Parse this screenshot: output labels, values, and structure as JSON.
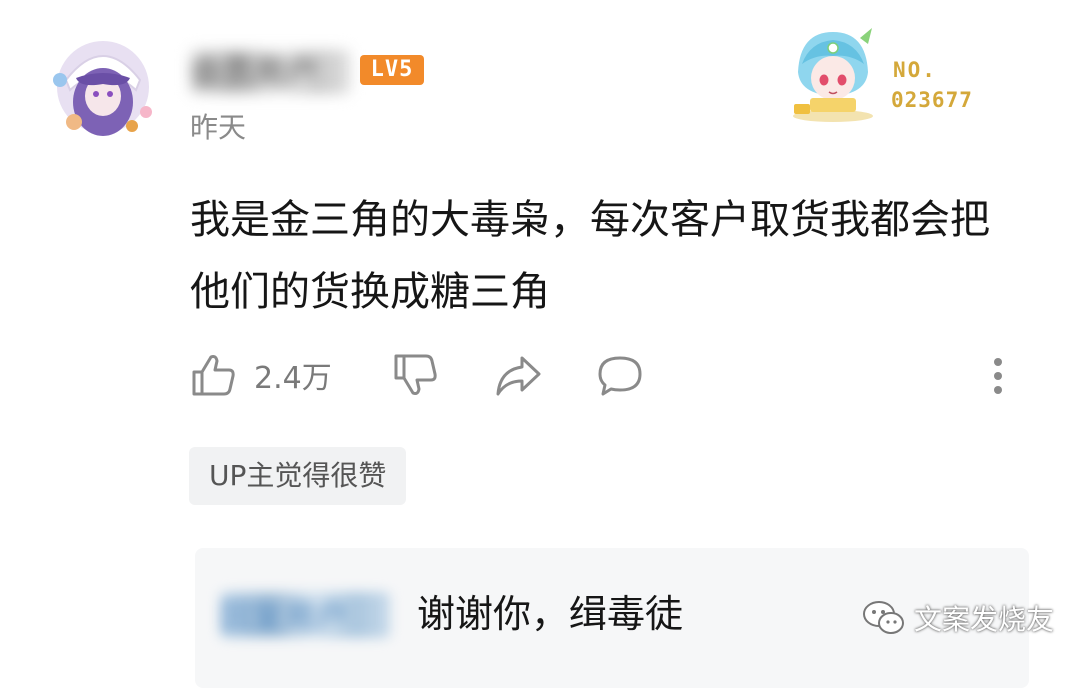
{
  "comment": {
    "username": "会员用户",
    "level": "LV5",
    "timestamp": "昨天",
    "text": "我是金三角的大毒枭，每次客户取货我都会把他们的货换成糖三角",
    "likes": "2.4万",
    "up_tag": "UP主觉得很赞"
  },
  "fan_badge": {
    "label": "NO.",
    "number": "023677"
  },
  "reply": {
    "username": "回复用户",
    "text": "谢谢你，缉毒徒"
  },
  "watermark": {
    "text": "文案发烧友"
  },
  "colors": {
    "level_badge": "#f28a2a",
    "fan_number": "#d4a83a",
    "icon_gray": "#8a8a8a",
    "reply_bg": "#f6f7f8",
    "tag_bg": "#f1f2f3"
  },
  "icons": {
    "like": "thumbs-up-icon",
    "dislike": "thumbs-down-icon",
    "share": "share-icon",
    "reply": "comment-icon",
    "more": "more-vertical-icon",
    "watermark": "wechat-icon"
  }
}
